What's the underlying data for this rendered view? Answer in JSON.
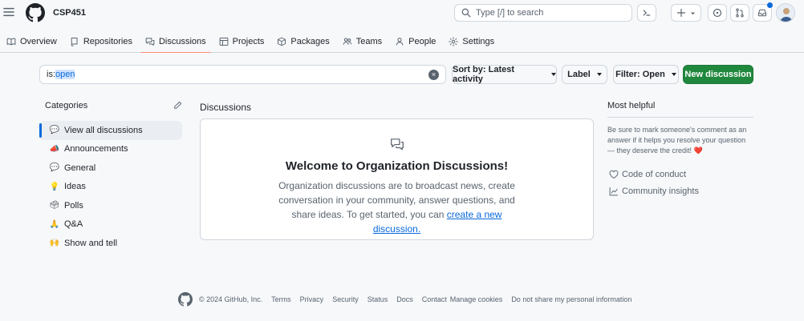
{
  "header": {
    "org_name": "CSP451",
    "search_placeholder": "Type [/] to search",
    "colors": {
      "accent": "#0969da",
      "brand_green": "#1f883d",
      "tab_underline": "#fd8c73"
    }
  },
  "tabs": [
    {
      "label": "Overview",
      "icon": "book-icon"
    },
    {
      "label": "Repositories",
      "icon": "repo-icon"
    },
    {
      "label": "Discussions",
      "icon": "discussions-icon",
      "active": true
    },
    {
      "label": "Projects",
      "icon": "table-icon"
    },
    {
      "label": "Packages",
      "icon": "package-icon"
    },
    {
      "label": "Teams",
      "icon": "people-icon"
    },
    {
      "label": "People",
      "icon": "person-icon"
    },
    {
      "label": "Settings",
      "icon": "gear-icon"
    }
  ],
  "toolbar": {
    "filter_prefix": "is:",
    "filter_highlight": "open",
    "sort_label": "Sort by: Latest activity",
    "label_label": "Label",
    "filter_label": "Filter: Open",
    "new_label": "New discussion"
  },
  "categories": {
    "heading": "Categories",
    "items": [
      {
        "emoji": "💬",
        "label": "View all discussions"
      },
      {
        "emoji": "📣",
        "label": "Announcements"
      },
      {
        "emoji": "💬",
        "label": "General"
      },
      {
        "emoji": "💡",
        "label": "Ideas"
      },
      {
        "emoji": "🗳",
        "label": "Polls"
      },
      {
        "emoji": "🙏",
        "label": "Q&A"
      },
      {
        "emoji": "🙌",
        "label": "Show and tell"
      }
    ]
  },
  "discussions": {
    "heading": "Discussions",
    "welcome_title": "Welcome to Organization Discussions!",
    "welcome_text": "Organization discussions are to broadcast news, create conversation in your community, answer questions, and share ideas. To get started, you can",
    "welcome_link": "create a new discussion."
  },
  "helpful": {
    "heading": "Most helpful",
    "text": "Be sure to mark someone's comment as an answer if it helps you resolve your question — they deserve the credit! ",
    "heart": "❤️",
    "links": [
      "Code of conduct",
      "Community insights"
    ]
  },
  "footer": {
    "copyright": "© 2024 GitHub, Inc.",
    "links": [
      "Terms",
      "Privacy",
      "Security",
      "Status",
      "Docs",
      "Contact",
      "Manage cookies",
      "Do not share my personal information"
    ]
  }
}
